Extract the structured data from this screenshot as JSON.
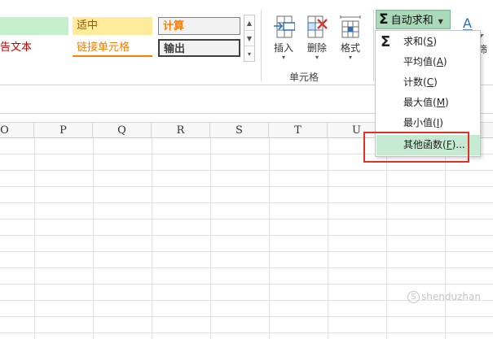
{
  "cell_styles": {
    "neutral": "适中",
    "calculation": "计算",
    "warning_text": "告文本",
    "linked_cell": "链接单元格",
    "output": "输出"
  },
  "cells_group": {
    "insert_label": "插入",
    "delete_label": "删除",
    "format_label": "格式",
    "group_label": "单元格"
  },
  "editing": {
    "autosum_label": "自动求和",
    "filter_label_partial": "筛"
  },
  "autosum_menu": {
    "items": [
      {
        "label": "求和(S)",
        "text": "求和(",
        "key": "S",
        "close": ")"
      },
      {
        "label": "平均值(A)",
        "text": "平均值(",
        "key": "A",
        "close": ")"
      },
      {
        "label": "计数(C)",
        "text": "计数(",
        "key": "C",
        "close": ")"
      },
      {
        "label": "最大值(M)",
        "text": "最大值(",
        "key": "M",
        "close": ")"
      },
      {
        "label": "最小值(I)",
        "text": "最小值(",
        "key": "I",
        "close": ")"
      },
      {
        "label": "其他函数(F)...",
        "text": "其他函数(",
        "key": "F",
        "close": ")..."
      }
    ],
    "highlighted_item": "其他函数(F)..."
  },
  "columns": [
    "O",
    "P",
    "Q",
    "R",
    "S",
    "T",
    "U"
  ],
  "watermark": "shenduzhan",
  "colors": {
    "neutral_fill": "#ffeb9c",
    "calculation_fill": "#f2f2f2",
    "calculation_text": "#fa7d00",
    "good_fill": "#c6efce",
    "warning_text": "#c00000",
    "autosum_fill": "#a9d9b9",
    "menu_highlight": "#c6e9d1",
    "annotation_red": "#e0302a"
  }
}
